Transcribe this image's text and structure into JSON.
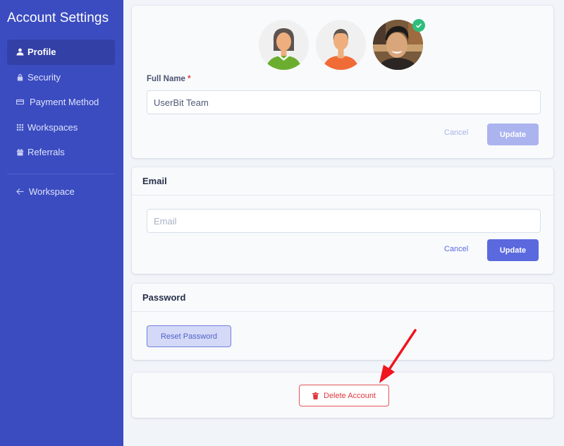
{
  "sidebar": {
    "title": "Account Settings",
    "items": [
      {
        "label": "Profile",
        "icon": "user-icon",
        "active": true
      },
      {
        "label": "Security",
        "icon": "lock-icon",
        "active": false
      },
      {
        "label": "Payment Method",
        "icon": "credit-card-icon",
        "active": false
      },
      {
        "label": "Workspaces",
        "icon": "grid-icon",
        "active": false
      },
      {
        "label": "Referrals",
        "icon": "gift-icon",
        "active": false
      }
    ],
    "back": {
      "label": "Workspace",
      "icon": "arrow-left-icon"
    }
  },
  "profile": {
    "avatars": [
      {
        "name": "female-avatar",
        "selected": false
      },
      {
        "name": "male-avatar",
        "selected": false
      },
      {
        "name": "photo-avatar",
        "selected": true
      }
    ],
    "full_name": {
      "label": "Full Name",
      "required_mark": "*",
      "value": "UserBit Team"
    },
    "cancel_label": "Cancel",
    "update_label": "Update"
  },
  "email": {
    "title": "Email",
    "placeholder": "Email",
    "value": "",
    "cancel_label": "Cancel",
    "update_label": "Update"
  },
  "password": {
    "title": "Password",
    "reset_label": "Reset Password"
  },
  "danger": {
    "delete_label": "Delete Account"
  },
  "colors": {
    "sidebar": "#3b4cc0",
    "primary": "#5a69de",
    "primary_disabled": "#abb4ef",
    "danger": "#e0353f",
    "success": "#2ebd7a"
  }
}
